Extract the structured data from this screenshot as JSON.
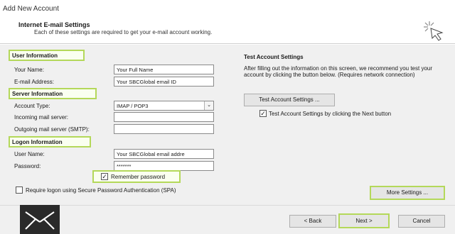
{
  "window": {
    "title": "Add New Account"
  },
  "header": {
    "title": "Internet E-mail Settings",
    "subtitle": "Each of these settings are required to get your e-mail account working."
  },
  "user_info": {
    "heading": "User Information",
    "name_label": "Your Name:",
    "name_value": "Your Full Name",
    "email_label": "E-mail Address:",
    "email_value": "Your SBCGlobal email ID"
  },
  "server_info": {
    "heading": "Server Information",
    "account_type_label": "Account Type:",
    "account_type_value": "IMAP /  POP3",
    "incoming_label": "Incoming mail server:",
    "incoming_value": "",
    "outgoing_label": "Outgoing mail server (SMTP):",
    "outgoing_value": ""
  },
  "logon_info": {
    "heading": "Logon Information",
    "username_label": "User Name:",
    "username_value": "Your SBCGlobal email addre",
    "password_label": "Password:",
    "password_value": "*******",
    "remember_label": "Remember password",
    "remember_checked": true,
    "spa_label": "Require logon using Secure Password Authentication (SPA)",
    "spa_checked": false
  },
  "test_settings": {
    "heading": "Test Account Settings",
    "description": "After filling out the information on this screen, we recommend you test your account by clicking the button below. (Requires network connection)",
    "button_label": "Test Account Settings ...",
    "next_check_label": "Test Account Settings by clicking the Next button",
    "next_check_checked": true
  },
  "more_settings_label": "More Settings ...",
  "footer": {
    "back_label": "< Back",
    "next_label": "Next >",
    "cancel_label": "Cancel"
  },
  "icons": {
    "wizard": "sparkle-cursor-icon",
    "logo": "envelope-icon",
    "checkmark": "✓"
  },
  "colors": {
    "highlight": "#b4d85a"
  }
}
